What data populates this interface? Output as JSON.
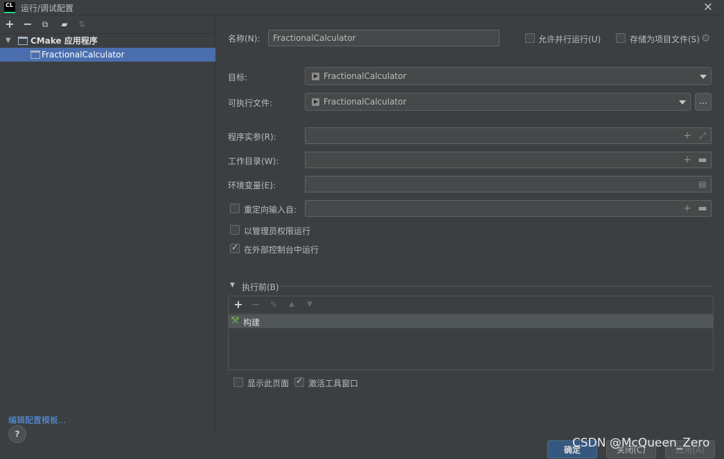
{
  "window": {
    "logo": "CL",
    "title": "运行/调试配置",
    "close_icon": "×"
  },
  "left_toolbar": {
    "add": "+",
    "remove": "−",
    "copy": "⧉",
    "folder": "▰",
    "sort": "⇅"
  },
  "tree": {
    "group_label": "CMake 应用程序",
    "item_label": "FractionalCalculator"
  },
  "edit_templates": "编辑配置模板...",
  "help": "?",
  "form": {
    "name_label": "名称(N):",
    "name_value": "FractionalCalculator",
    "allow_parallel": "允许并行运行(U)",
    "store_as_project_file": "存储为项目文件(S)",
    "target_label": "目标:",
    "target_value": "FractionalCalculator",
    "executable_label": "可执行文件:",
    "executable_value": "FractionalCalculator",
    "browse_label": "...",
    "program_args_label": "程序实参(R):",
    "working_dir_label": "工作目录(W):",
    "env_vars_label": "环境变量(E):",
    "redirect_input_label": "重定向输入自:",
    "run_as_admin_label": "以管理员权限运行",
    "run_in_external_console_label": "在外部控制台中运行",
    "before_launch_label": "执行前(B)",
    "build_task_label": "构建",
    "show_page_label": "显示此页面",
    "activate_tool_window_label": "激活工具窗口"
  },
  "buttons": {
    "ok": "确定",
    "cancel": "关闭(C)",
    "apply": "应用(A)"
  },
  "watermark": "CSDN @McQueen_Zero",
  "colors": {
    "selection": "#4b6eaf",
    "link": "#589df6",
    "ok_button": "#365880",
    "build_icon": "#6ab04c"
  }
}
